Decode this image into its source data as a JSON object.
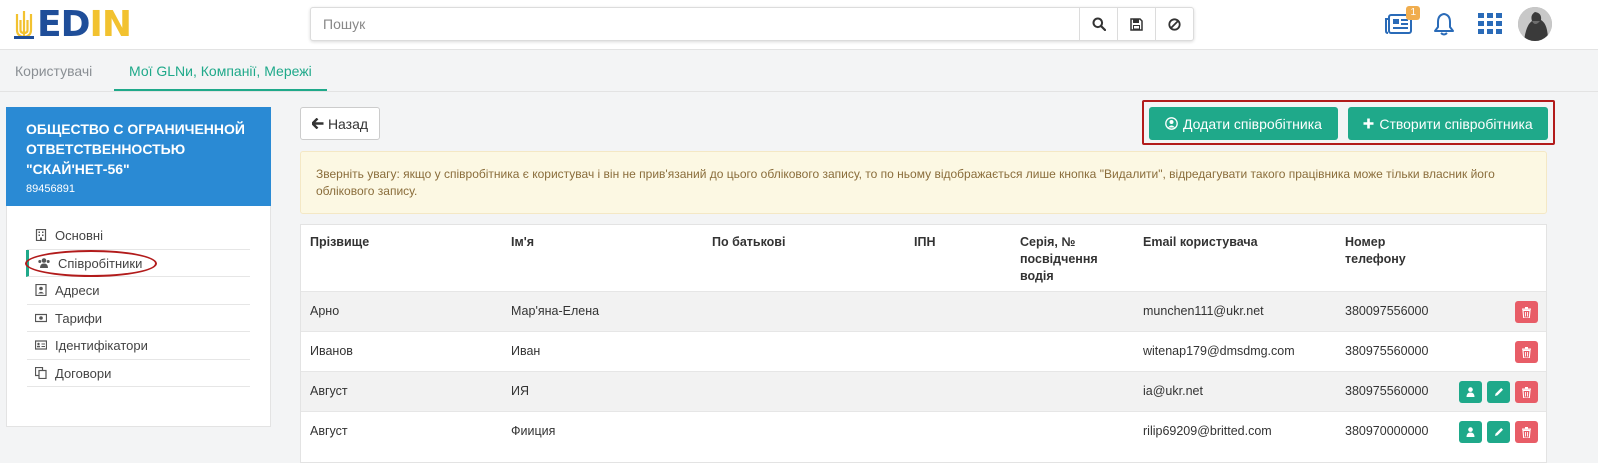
{
  "header": {
    "logo_text": "EDIN",
    "search_placeholder": "Пошук",
    "notifications_badge": "1"
  },
  "tabs": [
    {
      "label": "Користувачі",
      "active": false
    },
    {
      "label": "Мої GLNи, Компанії, Мережі",
      "active": true
    }
  ],
  "company": {
    "name": "ОБЩЕСТВО С ОГРАНИЧЕННОЙ ОТВЕТСТВЕННОСТЬЮ \"СКАЙ'НЕТ-56\"",
    "code": "89456891"
  },
  "sidebar": {
    "items": [
      {
        "label": "Основні",
        "icon": "building-icon"
      },
      {
        "label": "Співробітники",
        "icon": "users-icon",
        "active": true
      },
      {
        "label": "Адреси",
        "icon": "address-card-icon"
      },
      {
        "label": "Тарифи",
        "icon": "money-icon"
      },
      {
        "label": "Ідентифікатори",
        "icon": "id-card-icon"
      },
      {
        "label": "Договори",
        "icon": "copy-icon"
      }
    ]
  },
  "toolbar": {
    "back_label": "Назад",
    "add_label": "Додати співробітника",
    "create_label": "Створити співробітника"
  },
  "notice": "Зверніть увагу: якщо у співробітника є користувач і він не прив'язаний до цього облікового запису, то по ньому відображається лише кнопка \"Видалити\", відредагувати такого працівника може тільки власник його облікового запису.",
  "table": {
    "headers": [
      "Прізвище",
      "Ім'я",
      "По батькові",
      "ІПН",
      "Серія, № посвідчення водія",
      "Email користувача",
      "Номер телефону"
    ],
    "rows": [
      {
        "last": "Арно",
        "first": "Мар'яна-Елена",
        "middle": "",
        "ipn": "",
        "license": "",
        "email": "munchen111@ukr.net",
        "phone": "380097556000",
        "actions": [
          "delete"
        ]
      },
      {
        "last": "Иванов",
        "first": "Иван",
        "middle": "",
        "ipn": "",
        "license": "",
        "email": "witenap179@dmsdmg.com",
        "phone": "380975560000",
        "actions": [
          "delete"
        ]
      },
      {
        "last": "Август",
        "first": "ИЯ",
        "middle": "",
        "ipn": "",
        "license": "",
        "email": "ia@ukr.net",
        "phone": "380975560000",
        "actions": [
          "user",
          "edit",
          "delete"
        ]
      },
      {
        "last": "Август",
        "first": "Фииция",
        "middle": "",
        "ipn": "",
        "license": "",
        "email": "rilip69209@britted.com",
        "phone": "380970000000",
        "actions": [
          "user",
          "edit",
          "delete"
        ]
      }
    ]
  },
  "colors": {
    "brand_blue": "#1f4e99",
    "brand_yellow": "#f2c230",
    "accent_green": "#1fa98a",
    "company_blue": "#2a8ad4",
    "danger": "#e85d67",
    "highlight_red": "#b21b1b"
  }
}
